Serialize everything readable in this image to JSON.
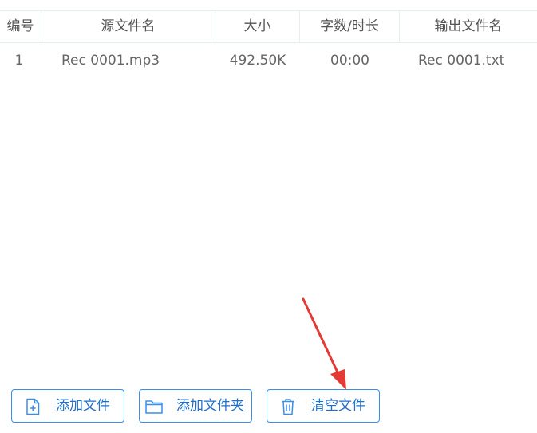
{
  "table": {
    "columns": [
      "编号",
      "源文件名",
      "大小",
      "字数/时长",
      "输出文件名"
    ],
    "rows": [
      {
        "index": "1",
        "source_name": "Rec 0001.mp3",
        "size": "492.50K",
        "duration": "00:00",
        "output_name": "Rec 0001.txt"
      }
    ]
  },
  "toolbar": {
    "add_file_label": "添加文件",
    "add_folder_label": "添加文件夹",
    "clear_files_label": "清空文件"
  },
  "icons": {
    "add_file": "file-plus-icon",
    "add_folder": "folder-icon",
    "clear_files": "trash-icon"
  },
  "colors": {
    "accent": "#1f6fcf",
    "button_border": "#3a8ee6",
    "grid_line": "#e6edf3",
    "annotation_arrow": "#e53935"
  }
}
